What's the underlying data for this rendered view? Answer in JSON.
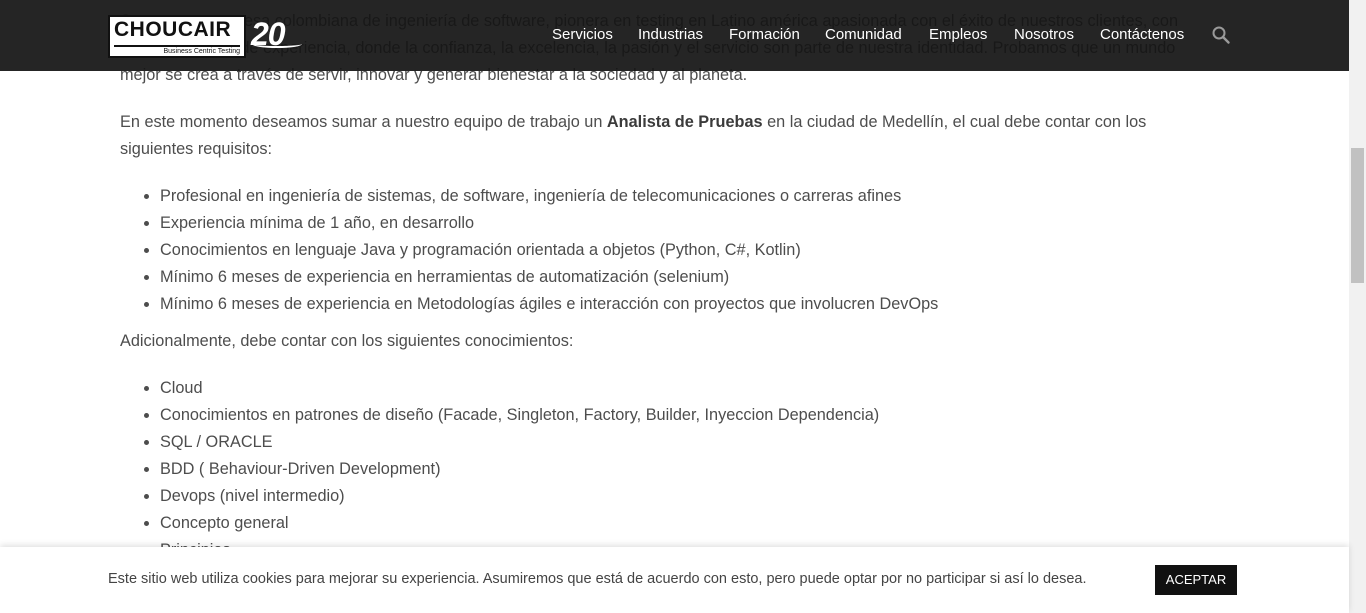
{
  "content": {
    "intro_text": "Somos una empresa colombiana de ingeniería de software, pionera en testing en Latino américa apasionada con el éxito de nuestros clientes, con más de 20 años de experiencia, donde la confianza, la excelencia, la pasión y el servicio son parte de nuestra identidad. Probamos que un mundo mejor se crea a través de servir, innovar y generar bienestar a la sociedad y al planeta.",
    "p2_before": "En este momento deseamos sumar a nuestro equipo de trabajo un ",
    "p2_bold": "Analista de Pruebas",
    "p2_after": " en la ciudad de Medellín, el cual debe contar con los siguientes requisitos:",
    "requirements": [
      "Profesional en ingeniería de sistemas, de software, ingeniería de telecomunicaciones o carreras afines",
      "Experiencia mínima de 1 año, en desarrollo",
      "Conocimientos en lenguaje Java y programación orientada a objetos (Python, C#, Kotlin)",
      "Mínimo 6 meses de experiencia en herramientas de automatización (selenium)",
      "Mínimo 6 meses de experiencia en Metodologías ágiles e interacción con proyectos que involucren DevOps"
    ],
    "p3": "Adicionalmente, debe contar con los siguientes conocimientos:",
    "knowledge": [
      "Cloud",
      "Conocimientos en patrones de diseño (Facade, Singleton, Factory, Builder, Inyeccion Dependencia)",
      "SQL / ORACLE",
      "BDD ( Behaviour-Driven Development)",
      "Devops (nivel intermedio)",
      "Concepto general",
      "Principios"
    ]
  },
  "header": {
    "logo_main": "CHOUCAIR",
    "logo_sub": "Business Centric Testing",
    "anniversary": "20",
    "nav": [
      "Servicios",
      "Industrias",
      "Formación",
      "Comunidad",
      "Empleos",
      "Nosotros",
      "Contáctenos"
    ],
    "search_icon": "search-icon"
  },
  "cookie": {
    "text": "Este sitio web utiliza cookies para mejorar su experiencia. Asumiremos que está de acuerdo con esto, pero puede optar por no participar si así lo desea.",
    "accept_label": "ACEPTAR"
  }
}
